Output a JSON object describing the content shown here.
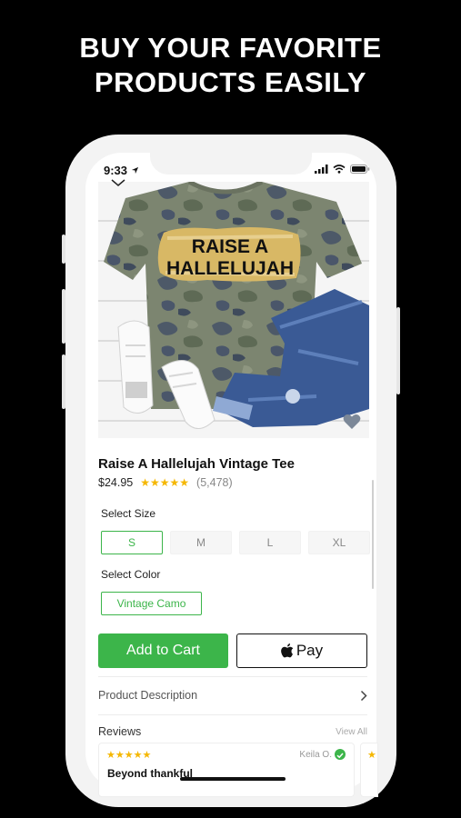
{
  "promo": {
    "line1": "BUY YOUR FAVORITE",
    "line2": "PRODUCTS EASILY"
  },
  "status_bar": {
    "time": "9:33"
  },
  "product": {
    "shirt_text_1": "RAISE A",
    "shirt_text_2": "HALLELUJAH",
    "title": "Raise A Hallelujah Vintage Tee",
    "price": "$24.95",
    "rating_stars": "★★★★★",
    "rating": 5,
    "review_count": "(5,478)"
  },
  "size": {
    "label": "Select Size",
    "options": [
      "S",
      "M",
      "L",
      "XL"
    ],
    "selected": "S"
  },
  "color": {
    "label": "Select Color",
    "selected": "Vintage Camo"
  },
  "actions": {
    "add_to_cart": "Add to Cart",
    "apple_pay": "Pay"
  },
  "description": {
    "label": "Product Description"
  },
  "reviews": {
    "title": "Reviews",
    "view_all": "View All",
    "items": [
      {
        "stars": "★★★★★",
        "author": "Keila O.",
        "title": "Beyond thankful"
      }
    ],
    "next_card_stars": "★"
  },
  "colors": {
    "accent": "#3cb54a",
    "star": "#f5b700",
    "background": "#000000"
  }
}
